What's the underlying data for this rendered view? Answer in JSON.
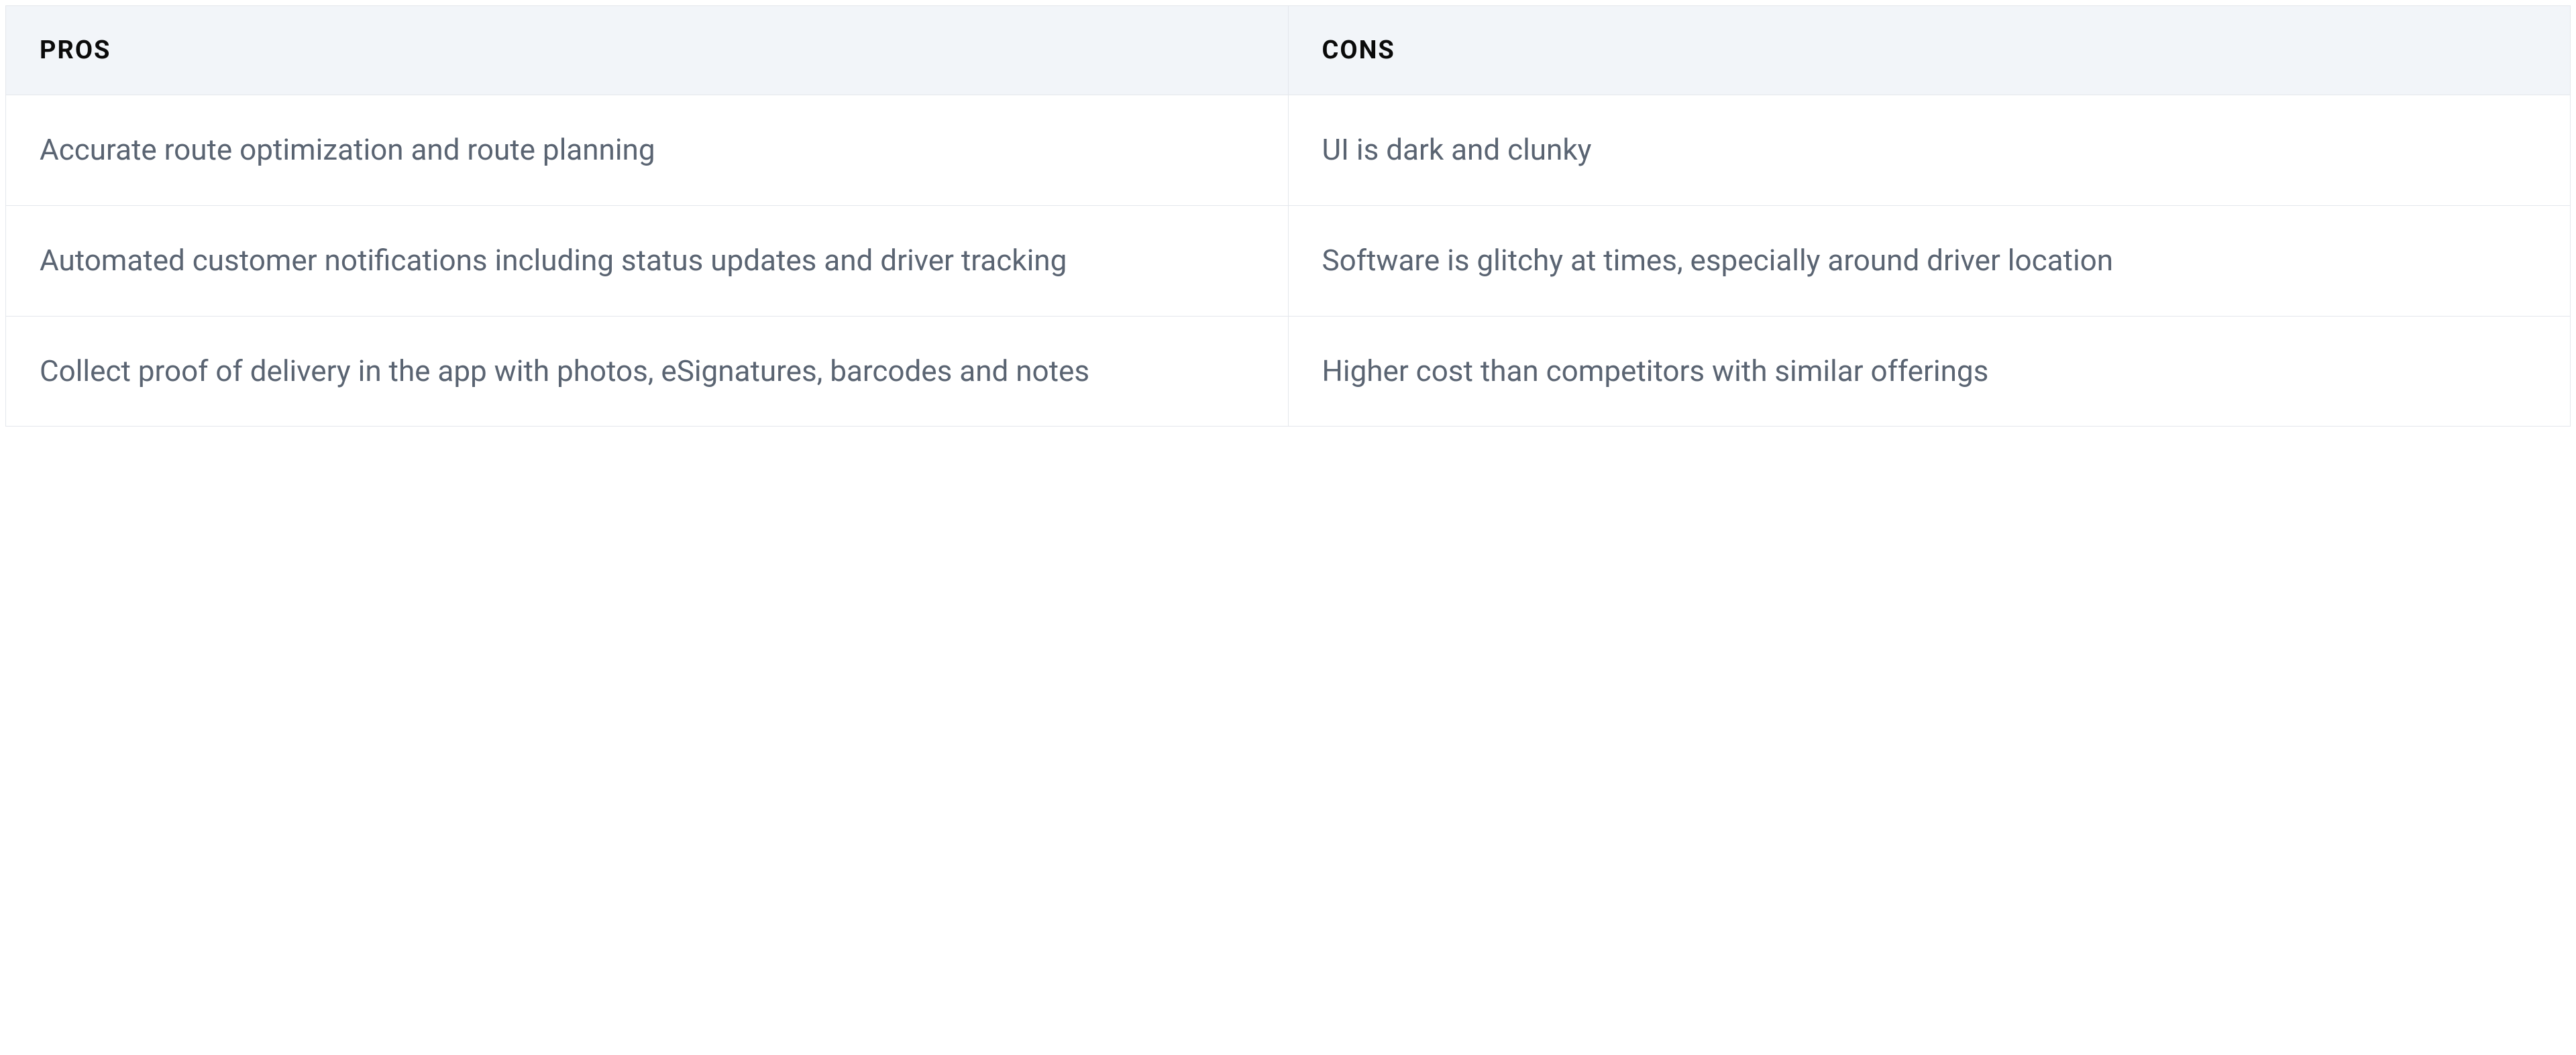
{
  "table": {
    "headers": {
      "pros": "PROS",
      "cons": "CONS"
    },
    "rows": [
      {
        "pro": "Accurate route optimization and route planning",
        "con": "UI is dark and clunky"
      },
      {
        "pro": "Automated customer notifications including status updates and driver tracking",
        "con": "Software is glitchy at times, especially around driver location"
      },
      {
        "pro": "Collect proof of delivery in the app with photos, eSignatures, barcodes and notes",
        "con": "Higher cost than competitors with similar offerings"
      }
    ]
  }
}
